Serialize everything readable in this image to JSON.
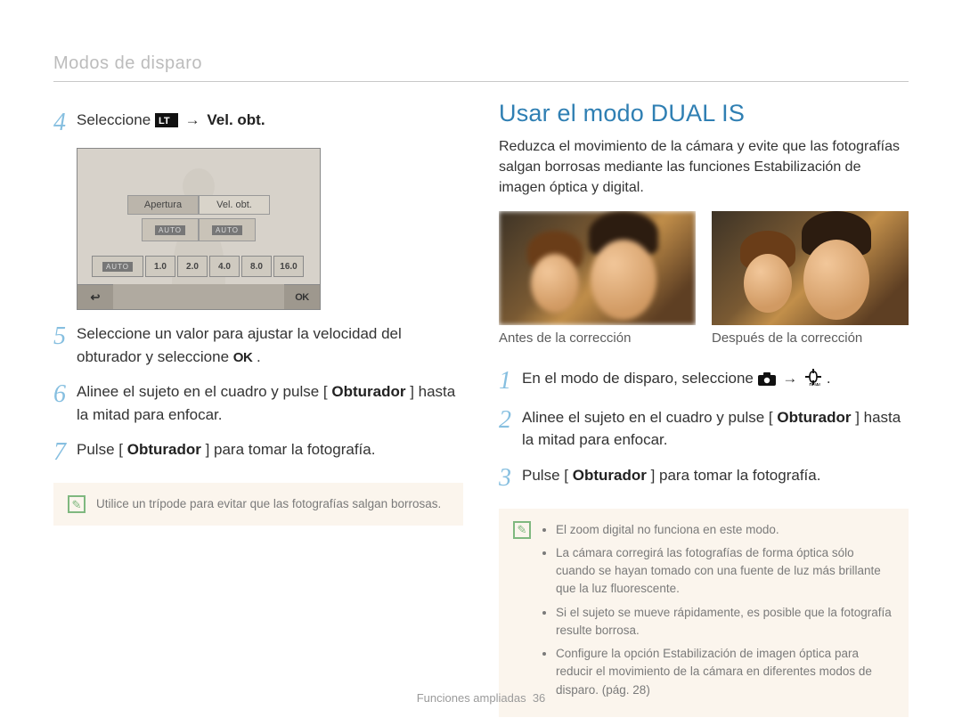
{
  "breadcrumb": "Modos de disparo",
  "left": {
    "step4": {
      "num": "4",
      "prefix": "Seleccione ",
      "icon_name": "lt-icon",
      "arrow": " → ",
      "suffix_bold": "Vel. obt."
    },
    "lcd": {
      "tab_left": "Apertura",
      "tab_right": "Vel. obt.",
      "auto_badge": "AUTO",
      "scale": [
        "1.0",
        "2.0",
        "4.0",
        "8.0",
        "16.0"
      ],
      "back_label": "↩",
      "ok_label": "OK"
    },
    "step5": {
      "num": "5",
      "text_a": "Seleccione un valor para ajustar la velocidad del obturador y seleccione ",
      "ok": "OK",
      "text_b": "."
    },
    "step6": {
      "num": "6",
      "text_a": "Alinee el sujeto en el cuadro y pulse [",
      "bold": "Obturador",
      "text_b": "] hasta la mitad para enfocar."
    },
    "step7": {
      "num": "7",
      "text_a": "Pulse [",
      "bold": "Obturador",
      "text_b": "] para tomar la fotografía."
    },
    "note": "Utilice un trípode para evitar que las fotografías salgan borrosas."
  },
  "right": {
    "heading": "Usar el modo DUAL IS",
    "intro": "Reduzca el movimiento de la cámara y evite que las fotografías salgan borrosas mediante las funciones Estabilización de imagen óptica y digital.",
    "caption_left": "Antes de la corrección",
    "caption_right": "Después de la corrección",
    "step1": {
      "num": "1",
      "text_a": "En el modo de disparo, seleccione ",
      "icon1": "camera-icon",
      "arrow": " → ",
      "icon2": "dual-is-icon",
      "text_b": "."
    },
    "step2": {
      "num": "2",
      "text_a": "Alinee el sujeto en el cuadro y pulse [",
      "bold": "Obturador",
      "text_b": "] hasta la mitad para enfocar."
    },
    "step3": {
      "num": "3",
      "text_a": "Pulse [",
      "bold": "Obturador",
      "text_b": "] para tomar la fotografía."
    },
    "notes": [
      "El zoom digital no funciona en este modo.",
      "La cámara corregirá las fotografías de forma óptica sólo cuando se hayan tomado con una fuente de luz más brillante que la luz fluorescente.",
      "Si el sujeto se mueve rápidamente, es posible que la fotografía resulte borrosa.",
      "Configure la opción Estabilización de imagen óptica para reducir el movimiento de la cámara en diferentes modos de disparo. (pág. 28)"
    ]
  },
  "footer": {
    "section": "Funciones ampliadas",
    "page": "36"
  }
}
